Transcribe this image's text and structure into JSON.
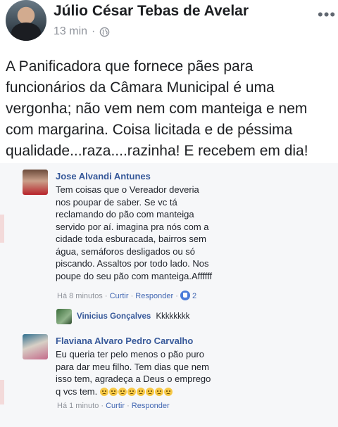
{
  "post": {
    "author": "Júlio César Tebas de Avelar",
    "time": "13 min",
    "separator": "·",
    "more_glyph": "•••",
    "text": "A Panificadora que fornece pães para funcionários da Câmara Municipal é uma vergonha; não vem nem com manteiga e nem com margarina. Coisa licitada e de péssima qualidade...raza....razinha! E recebem em dia!"
  },
  "comments": [
    {
      "name": "Jose Alvandi Antunes",
      "lines": [
        "Tem coisas que o Vereador deveria",
        "nos poupar de saber. Se vc tá",
        "reclamando do pão com manteiga",
        "servido por aí. imagina pra nós com a",
        "cidade toda esburacada, bairros sem",
        "água, semáforos desligados ou só",
        "piscando. Assaltos por todo lado. Nos",
        "poupe do seu pão com manteiga.Affffff"
      ],
      "time": "Há 8 minutos",
      "like": "Curtir",
      "reply": "Responder",
      "reaction_count": "2"
    },
    {
      "name": "Vinicius Gonçalves",
      "text": "Kkkkkkkk"
    },
    {
      "name": "Flaviana Alvaro Pedro Carvalho",
      "lines": [
        "Eu queria ter pelo menos o pão puro",
        "para dar meu filho. Tem dias que nem",
        "isso tem, agradeça a Deus o emprego",
        "q vcs tem."
      ],
      "time": "Há 1 minuto",
      "like": "Curtir",
      "reply": "Responder"
    }
  ],
  "separators": {
    "dot": "·"
  },
  "icons": [
    "globe-icon",
    "more-options-icon",
    "like-reaction-icon",
    "crying-emoji-icon"
  ],
  "colors": {
    "name_link": "#365899",
    "action_link": "#4267b2",
    "muted": "#90949c",
    "like_blue": "#4a7bd9"
  }
}
